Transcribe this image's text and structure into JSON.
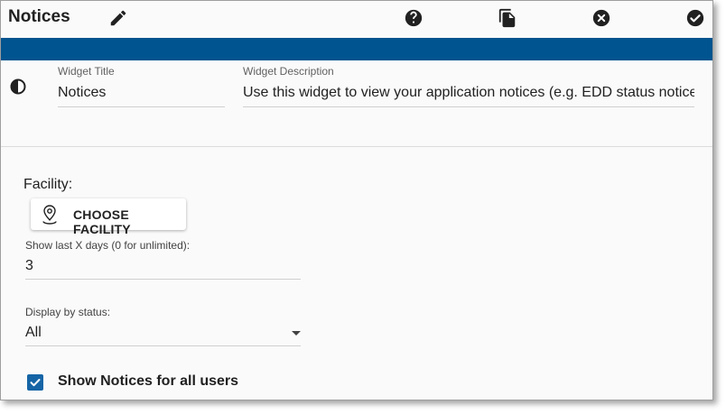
{
  "header": {
    "title": "Notices",
    "icons": [
      "edit-icon",
      "help-icon",
      "copy-icon",
      "close-icon",
      "check-icon"
    ]
  },
  "widget": {
    "title_label": "Widget Title",
    "title_value": "Notices",
    "description_label": "Widget Description",
    "description_value": "Use this widget to view your application notices (e.g. EDD status notices)"
  },
  "facility": {
    "label": "Facility:",
    "button_label": "CHOOSE FACILITY"
  },
  "days": {
    "label": "Show last X days (0 for unlimited):",
    "value": "3"
  },
  "status": {
    "label": "Display by status:",
    "value": "All"
  },
  "all_users": {
    "label": "Show Notices for all users",
    "checked": true
  },
  "colors": {
    "accent_bar": "#00548f",
    "checkbox": "#1565a6"
  }
}
